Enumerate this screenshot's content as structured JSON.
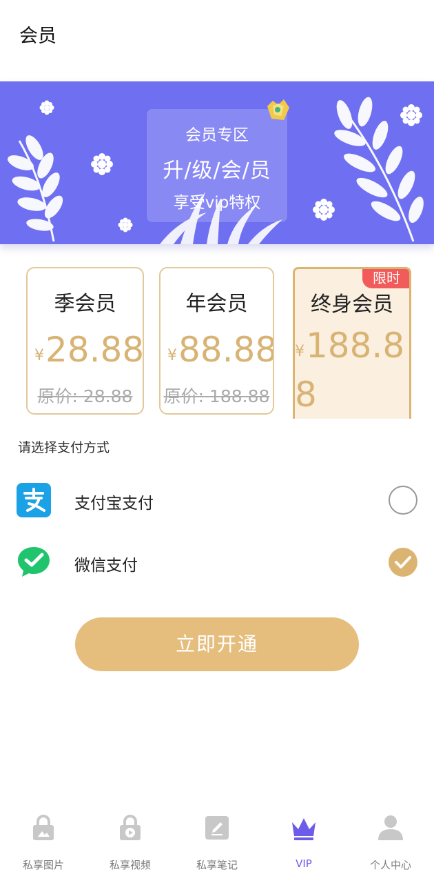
{
  "header": {
    "title": "会员"
  },
  "banner": {
    "subtitle": "会员专区",
    "headline": "升/级/会/员",
    "desc": "享受vip特权"
  },
  "plans": [
    {
      "name": "季会员",
      "currency": "¥",
      "price": "28.88",
      "original": "原价: 28.88"
    },
    {
      "name": "年会员",
      "currency": "¥",
      "price": "88.88",
      "original": "原价: 188.88"
    },
    {
      "name": "终身会员",
      "currency": "¥",
      "price": "188.88",
      "badge": "限时",
      "selected": true
    }
  ],
  "payment": {
    "prompt": "请选择支付方式",
    "methods": [
      {
        "label": "支付宝支付",
        "icon": "alipay-icon",
        "selected": false
      },
      {
        "label": "微信支付",
        "icon": "wechat-icon",
        "selected": true
      }
    ]
  },
  "action": {
    "open_label": "立即开通"
  },
  "tabbar": {
    "items": [
      {
        "label": "私享图片",
        "icon": "lock-image-icon",
        "active": false
      },
      {
        "label": "私享视频",
        "icon": "lock-video-icon",
        "active": false
      },
      {
        "label": "私享笔记",
        "icon": "note-edit-icon",
        "active": false
      },
      {
        "label": "VIP",
        "icon": "crown-icon",
        "active": true
      },
      {
        "label": "个人中心",
        "icon": "person-icon",
        "active": false
      }
    ]
  },
  "colors": {
    "banner": "#6f6ff2",
    "gold": "#dcb471",
    "button": "#e5bd7d",
    "active_tab": "#6c5ce7",
    "badge": "#f25b5b"
  }
}
